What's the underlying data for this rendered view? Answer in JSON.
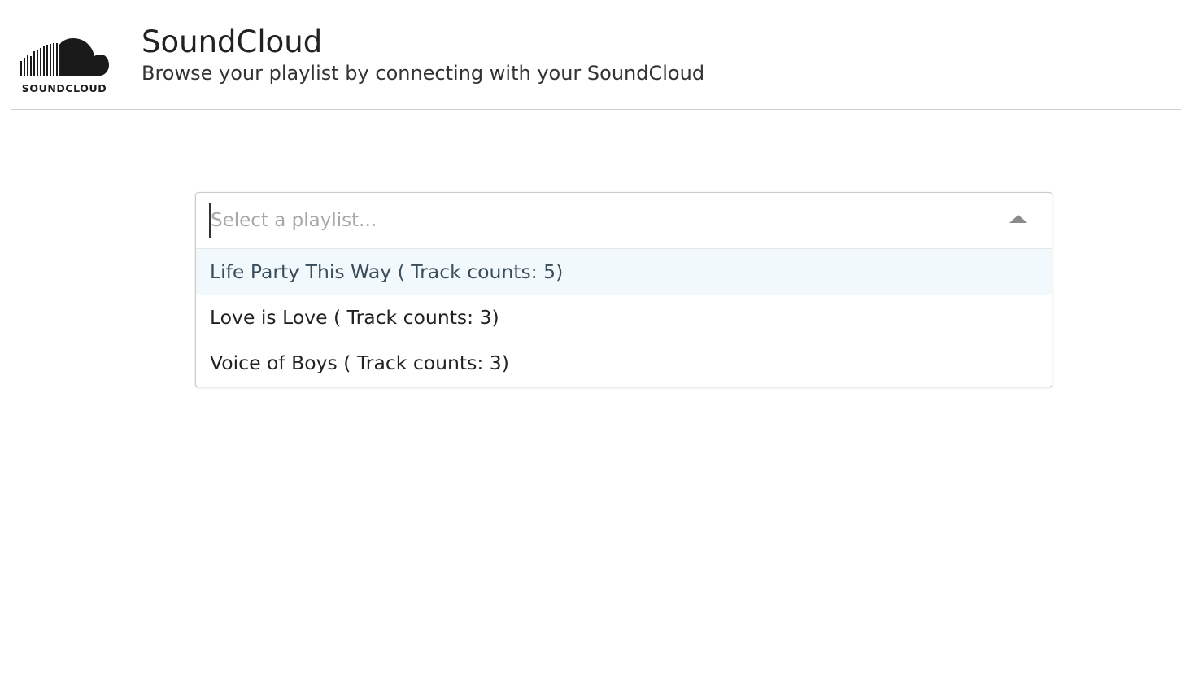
{
  "header": {
    "logo_icon": "soundcloud-cloud-logo-icon",
    "logo_text": "SOUNDCLOUD",
    "title": "SoundCloud",
    "subtitle": "Browse your playlist by connecting with your SoundCloud"
  },
  "playlist_select": {
    "placeholder": "Select a playlist...",
    "value": "",
    "arrow_icon": "caret-up-icon",
    "expanded": true,
    "options": [
      {
        "label": "Life Party This Way ( Track counts: 5)",
        "focused": true
      },
      {
        "label": "Love is Love ( Track counts: 3)",
        "focused": false
      },
      {
        "label": "Voice of Boys ( Track counts: 3)",
        "focused": false
      }
    ]
  },
  "colors": {
    "option_focus_bg": "#f2f9fc",
    "border": "#c9c9c9",
    "header_rule": "#cfcfcf",
    "placeholder": "#a8a8a8"
  }
}
